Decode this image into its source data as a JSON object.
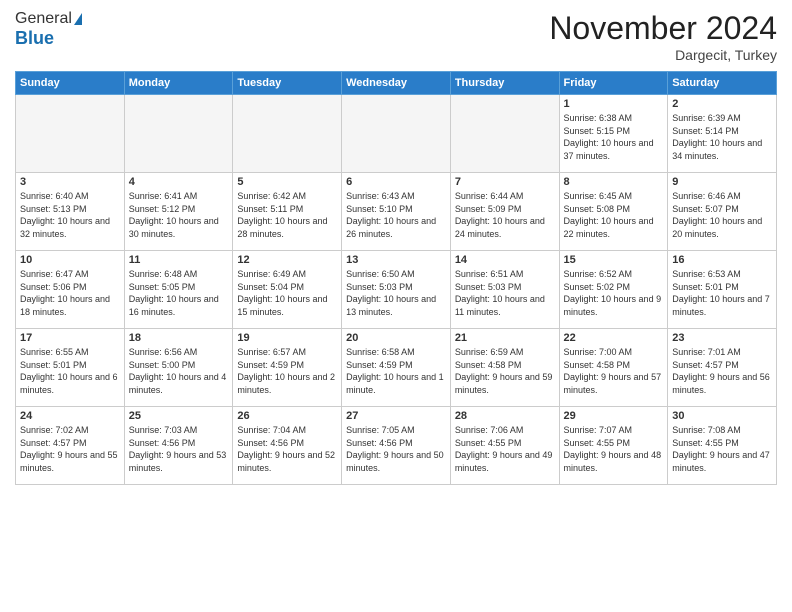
{
  "header": {
    "logo_general": "General",
    "logo_blue": "Blue",
    "month_title": "November 2024",
    "location": "Dargecit, Turkey"
  },
  "weekdays": [
    "Sunday",
    "Monday",
    "Tuesday",
    "Wednesday",
    "Thursday",
    "Friday",
    "Saturday"
  ],
  "weeks": [
    [
      {
        "day": "",
        "info": ""
      },
      {
        "day": "",
        "info": ""
      },
      {
        "day": "",
        "info": ""
      },
      {
        "day": "",
        "info": ""
      },
      {
        "day": "",
        "info": ""
      },
      {
        "day": "1",
        "info": "Sunrise: 6:38 AM\nSunset: 5:15 PM\nDaylight: 10 hours and 37 minutes."
      },
      {
        "day": "2",
        "info": "Sunrise: 6:39 AM\nSunset: 5:14 PM\nDaylight: 10 hours and 34 minutes."
      }
    ],
    [
      {
        "day": "3",
        "info": "Sunrise: 6:40 AM\nSunset: 5:13 PM\nDaylight: 10 hours and 32 minutes."
      },
      {
        "day": "4",
        "info": "Sunrise: 6:41 AM\nSunset: 5:12 PM\nDaylight: 10 hours and 30 minutes."
      },
      {
        "day": "5",
        "info": "Sunrise: 6:42 AM\nSunset: 5:11 PM\nDaylight: 10 hours and 28 minutes."
      },
      {
        "day": "6",
        "info": "Sunrise: 6:43 AM\nSunset: 5:10 PM\nDaylight: 10 hours and 26 minutes."
      },
      {
        "day": "7",
        "info": "Sunrise: 6:44 AM\nSunset: 5:09 PM\nDaylight: 10 hours and 24 minutes."
      },
      {
        "day": "8",
        "info": "Sunrise: 6:45 AM\nSunset: 5:08 PM\nDaylight: 10 hours and 22 minutes."
      },
      {
        "day": "9",
        "info": "Sunrise: 6:46 AM\nSunset: 5:07 PM\nDaylight: 10 hours and 20 minutes."
      }
    ],
    [
      {
        "day": "10",
        "info": "Sunrise: 6:47 AM\nSunset: 5:06 PM\nDaylight: 10 hours and 18 minutes."
      },
      {
        "day": "11",
        "info": "Sunrise: 6:48 AM\nSunset: 5:05 PM\nDaylight: 10 hours and 16 minutes."
      },
      {
        "day": "12",
        "info": "Sunrise: 6:49 AM\nSunset: 5:04 PM\nDaylight: 10 hours and 15 minutes."
      },
      {
        "day": "13",
        "info": "Sunrise: 6:50 AM\nSunset: 5:03 PM\nDaylight: 10 hours and 13 minutes."
      },
      {
        "day": "14",
        "info": "Sunrise: 6:51 AM\nSunset: 5:03 PM\nDaylight: 10 hours and 11 minutes."
      },
      {
        "day": "15",
        "info": "Sunrise: 6:52 AM\nSunset: 5:02 PM\nDaylight: 10 hours and 9 minutes."
      },
      {
        "day": "16",
        "info": "Sunrise: 6:53 AM\nSunset: 5:01 PM\nDaylight: 10 hours and 7 minutes."
      }
    ],
    [
      {
        "day": "17",
        "info": "Sunrise: 6:55 AM\nSunset: 5:01 PM\nDaylight: 10 hours and 6 minutes."
      },
      {
        "day": "18",
        "info": "Sunrise: 6:56 AM\nSunset: 5:00 PM\nDaylight: 10 hours and 4 minutes."
      },
      {
        "day": "19",
        "info": "Sunrise: 6:57 AM\nSunset: 4:59 PM\nDaylight: 10 hours and 2 minutes."
      },
      {
        "day": "20",
        "info": "Sunrise: 6:58 AM\nSunset: 4:59 PM\nDaylight: 10 hours and 1 minute."
      },
      {
        "day": "21",
        "info": "Sunrise: 6:59 AM\nSunset: 4:58 PM\nDaylight: 9 hours and 59 minutes."
      },
      {
        "day": "22",
        "info": "Sunrise: 7:00 AM\nSunset: 4:58 PM\nDaylight: 9 hours and 57 minutes."
      },
      {
        "day": "23",
        "info": "Sunrise: 7:01 AM\nSunset: 4:57 PM\nDaylight: 9 hours and 56 minutes."
      }
    ],
    [
      {
        "day": "24",
        "info": "Sunrise: 7:02 AM\nSunset: 4:57 PM\nDaylight: 9 hours and 55 minutes."
      },
      {
        "day": "25",
        "info": "Sunrise: 7:03 AM\nSunset: 4:56 PM\nDaylight: 9 hours and 53 minutes."
      },
      {
        "day": "26",
        "info": "Sunrise: 7:04 AM\nSunset: 4:56 PM\nDaylight: 9 hours and 52 minutes."
      },
      {
        "day": "27",
        "info": "Sunrise: 7:05 AM\nSunset: 4:56 PM\nDaylight: 9 hours and 50 minutes."
      },
      {
        "day": "28",
        "info": "Sunrise: 7:06 AM\nSunset: 4:55 PM\nDaylight: 9 hours and 49 minutes."
      },
      {
        "day": "29",
        "info": "Sunrise: 7:07 AM\nSunset: 4:55 PM\nDaylight: 9 hours and 48 minutes."
      },
      {
        "day": "30",
        "info": "Sunrise: 7:08 AM\nSunset: 4:55 PM\nDaylight: 9 hours and 47 minutes."
      }
    ]
  ]
}
